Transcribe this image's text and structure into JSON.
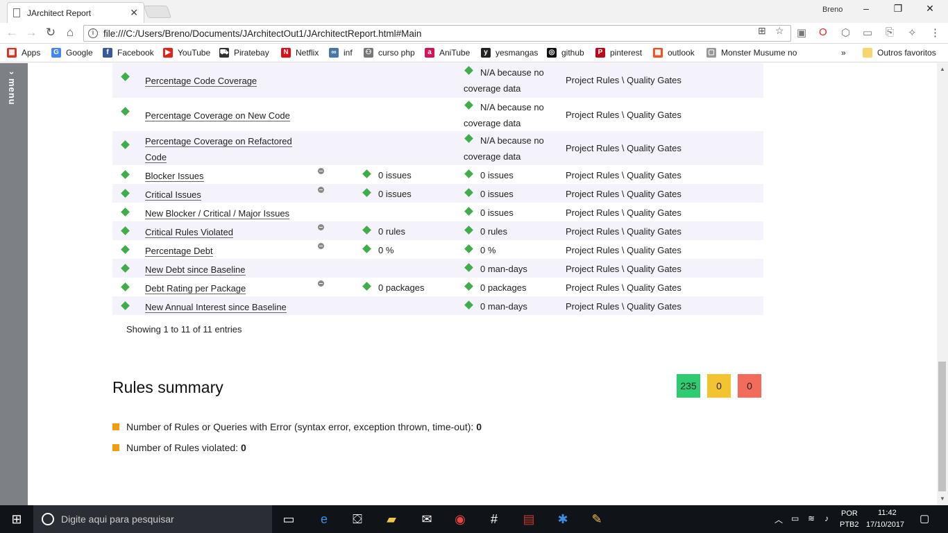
{
  "browser": {
    "tab_title": "JArchitect Report",
    "user": "Breno",
    "url": "file:///C:/Users/Breno/Documents/JArchitectOut1/JArchitectReport.html#Main"
  },
  "bookmarks": [
    {
      "label": "Apps",
      "color": "#d93025"
    },
    {
      "label": "Google",
      "color": "#4285f4"
    },
    {
      "label": "Facebook",
      "color": "#3b5998"
    },
    {
      "label": "YouTube",
      "color": "#e62117"
    },
    {
      "label": "Piratebay",
      "color": "#333333"
    },
    {
      "label": "Netflix",
      "color": "#e50914"
    },
    {
      "label": "inf",
      "color": "#4a76a8"
    },
    {
      "label": "curso php",
      "color": "#777777"
    },
    {
      "label": "AniTube",
      "color": "#d4145a"
    },
    {
      "label": "yesmangas",
      "color": "#222222"
    },
    {
      "label": "github",
      "color": "#111111"
    },
    {
      "label": "pinterest",
      "color": "#bd081c"
    },
    {
      "label": "outlook",
      "color": "#f25022"
    },
    {
      "label": "Monster Musume no",
      "color": "#999999"
    }
  ],
  "bookmarks_more": "»",
  "bookmarks_other": "Outros favoritos",
  "menu_label": "menu",
  "table": {
    "rows": [
      {
        "name": "Percentage Code Coverage",
        "dot": false,
        "val": "",
        "status": "N/A because no coverage data",
        "group": "Project Rules \\ Quality Gates"
      },
      {
        "name": "Percentage Coverage on New Code",
        "dot": false,
        "val": "",
        "status": "N/A because no coverage data",
        "group": "Project Rules \\ Quality Gates"
      },
      {
        "name": "Percentage Coverage on Refactored Code",
        "dot": false,
        "val": "",
        "status": "N/A because no coverage data",
        "group": "Project Rules \\ Quality Gates"
      },
      {
        "name": "Blocker Issues",
        "dot": true,
        "val": "0 issues",
        "status": "0 issues",
        "group": "Project Rules \\ Quality Gates"
      },
      {
        "name": "Critical Issues",
        "dot": true,
        "val": "0 issues",
        "status": "0 issues",
        "group": "Project Rules \\ Quality Gates"
      },
      {
        "name": "New Blocker / Critical / Major Issues",
        "dot": false,
        "val": "",
        "status": "0 issues",
        "group": "Project Rules \\ Quality Gates"
      },
      {
        "name": "Critical Rules Violated",
        "dot": true,
        "val": "0 rules",
        "status": "0 rules",
        "group": "Project Rules \\ Quality Gates"
      },
      {
        "name": "Percentage Debt",
        "dot": true,
        "val": "0 %",
        "status": "0 %",
        "group": "Project Rules \\ Quality Gates"
      },
      {
        "name": "New Debt since Baseline",
        "dot": false,
        "val": "",
        "status": "0 man-days",
        "group": "Project Rules \\ Quality Gates"
      },
      {
        "name": "Debt Rating per Package",
        "dot": true,
        "val": "0 packages",
        "status": "0 packages",
        "group": "Project Rules \\ Quality Gates"
      },
      {
        "name": "New Annual Interest since Baseline",
        "dot": false,
        "val": "",
        "status": "0 man-days",
        "group": "Project Rules \\ Quality Gates"
      }
    ],
    "showing": "Showing 1 to 11 of 11 entries"
  },
  "summary": {
    "title": "Rules summary",
    "boxes": [
      {
        "value": "235",
        "color": "#2ecc71"
      },
      {
        "value": "0",
        "color": "#f4c430"
      },
      {
        "value": "0",
        "color": "#f26b5b"
      }
    ],
    "lines": [
      {
        "label": "Number of Rules or Queries with Error (syntax error, exception thrown, time-out): ",
        "value": "0"
      },
      {
        "label": "Number of Rules violated: ",
        "value": "0"
      }
    ]
  },
  "taskbar": {
    "search_placeholder": "Digite aqui para pesquisar",
    "lang1": "POR",
    "lang2": "PTB2",
    "time": "11:42",
    "date": "17/10/2017"
  }
}
